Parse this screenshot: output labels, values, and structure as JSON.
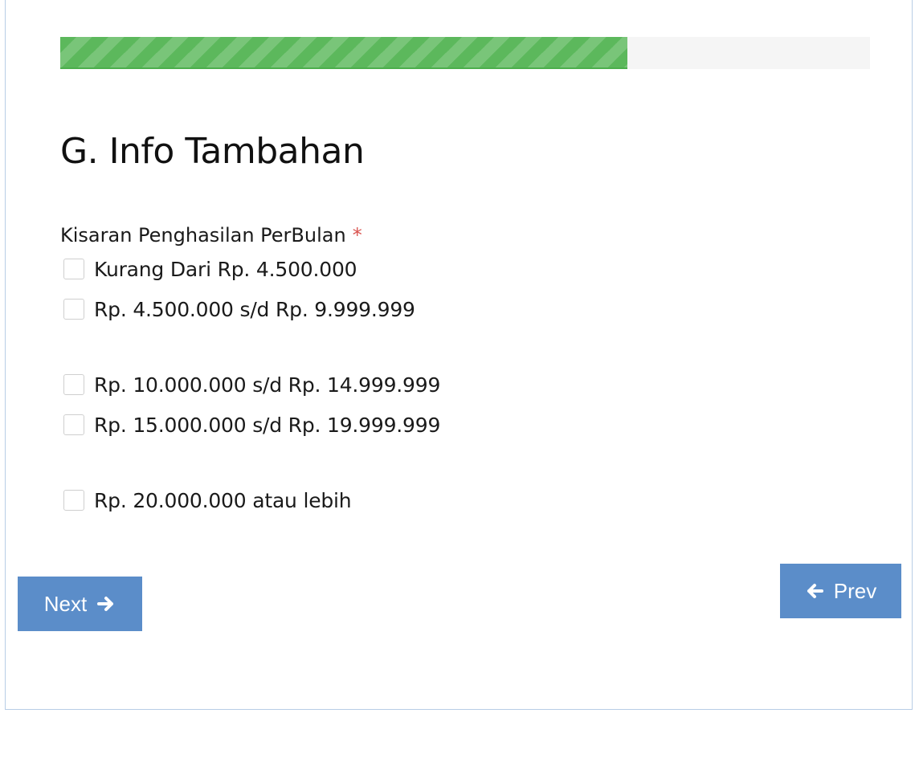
{
  "progress": {
    "percent": 70
  },
  "section": {
    "title": "G. Info Tambahan"
  },
  "income_field": {
    "label": "Kisaran Penghasilan PerBulan",
    "required_mark": "*",
    "options": [
      {
        "label": "Kurang Dari Rp. 4.500.000",
        "checked": false
      },
      {
        "label": "Rp. 4.500.000 s/d Rp. 9.999.999",
        "checked": false
      },
      {
        "label": "Rp. 10.000.000 s/d Rp. 14.999.999",
        "checked": false
      },
      {
        "label": "Rp. 15.000.000 s/d Rp. 19.999.999",
        "checked": false
      },
      {
        "label": "Rp. 20.000.000 atau lebih",
        "checked": false
      }
    ]
  },
  "navigation": {
    "next_label": "Next",
    "next_icon": "arrow-right-icon",
    "prev_label": "Prev",
    "prev_icon": "arrow-left-icon"
  },
  "colors": {
    "progress_fill": "#5cb85c",
    "progress_track": "#f5f5f5",
    "button": "#5b8dc9",
    "required": "#d9534f",
    "frame_border": "#b8cde6"
  }
}
